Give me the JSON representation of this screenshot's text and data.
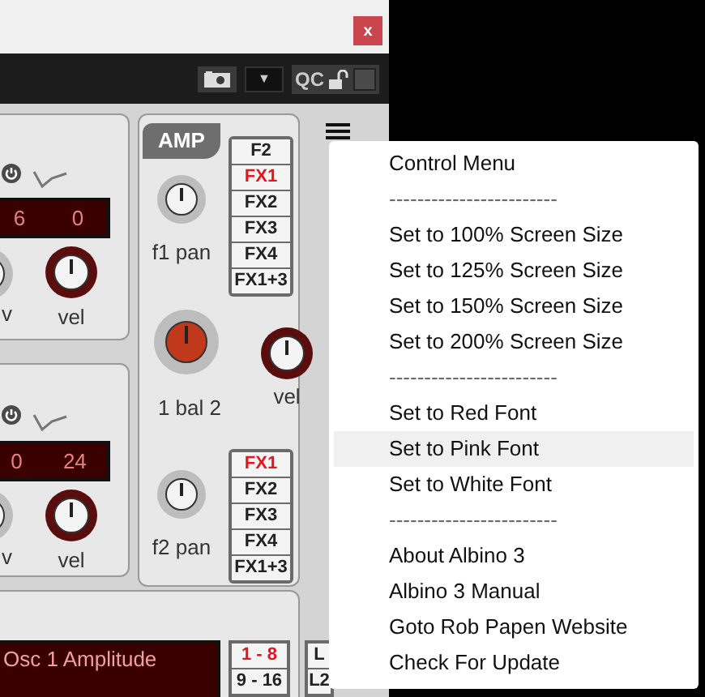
{
  "window": {
    "close_label": "x"
  },
  "toolbar": {
    "dropdown_caret": "▼",
    "qc_label": "QC"
  },
  "osc_1": {
    "values": [
      "6",
      "0"
    ],
    "knob_labels": [
      "v",
      "vel"
    ]
  },
  "amp_1": {
    "title": "AMP",
    "knob_label": "f1 pan",
    "fx_buttons": [
      {
        "label": "F2",
        "selected": false
      },
      {
        "label": "FX1",
        "selected": true
      },
      {
        "label": "FX2",
        "selected": false
      },
      {
        "label": "FX3",
        "selected": false
      },
      {
        "label": "FX4",
        "selected": false
      },
      {
        "label": "FX1+3",
        "selected": false
      }
    ]
  },
  "balance": {
    "label": "1 bal 2",
    "vel_label": "vel"
  },
  "osc_2": {
    "values": [
      "0",
      "24"
    ],
    "knob_labels": [
      "v",
      "vel"
    ]
  },
  "amp_2": {
    "knob_label": "f2 pan",
    "fx_buttons": [
      {
        "label": "FX1",
        "selected": true
      },
      {
        "label": "FX2",
        "selected": false
      },
      {
        "label": "FX3",
        "selected": false
      },
      {
        "label": "FX4",
        "selected": false
      },
      {
        "label": "FX1+3",
        "selected": false
      }
    ]
  },
  "mod": {
    "display_line": "Osc 1 Amplitude",
    "page_buttons": [
      {
        "label": "1 - 8",
        "selected": true
      },
      {
        "label": "9 - 16",
        "selected": false
      }
    ],
    "side_buttons": [
      "L",
      "L2"
    ]
  },
  "menu": {
    "items": [
      {
        "kind": "item",
        "label": "Control Menu",
        "selected": false
      },
      {
        "kind": "separator",
        "label": "------------------------",
        "selected": false
      },
      {
        "kind": "item",
        "label": "Set to 100% Screen Size",
        "selected": false
      },
      {
        "kind": "item",
        "label": "Set to 125% Screen Size",
        "selected": false
      },
      {
        "kind": "item",
        "label": "Set to 150% Screen Size",
        "selected": false
      },
      {
        "kind": "item",
        "label": "Set to 200% Screen Size",
        "selected": false
      },
      {
        "kind": "separator",
        "label": "------------------------",
        "selected": false
      },
      {
        "kind": "item",
        "label": "Set to Red Font",
        "selected": false
      },
      {
        "kind": "item",
        "label": "Set to Pink Font",
        "selected": true
      },
      {
        "kind": "item",
        "label": "Set to White Font",
        "selected": false
      },
      {
        "kind": "separator",
        "label": "------------------------",
        "selected": false
      },
      {
        "kind": "item",
        "label": "About Albino 3",
        "selected": false
      },
      {
        "kind": "item",
        "label": "Albino 3 Manual",
        "selected": false
      },
      {
        "kind": "item",
        "label": "Goto Rob Papen Website",
        "selected": false
      },
      {
        "kind": "item",
        "label": "Check For Update",
        "selected": false
      }
    ]
  }
}
